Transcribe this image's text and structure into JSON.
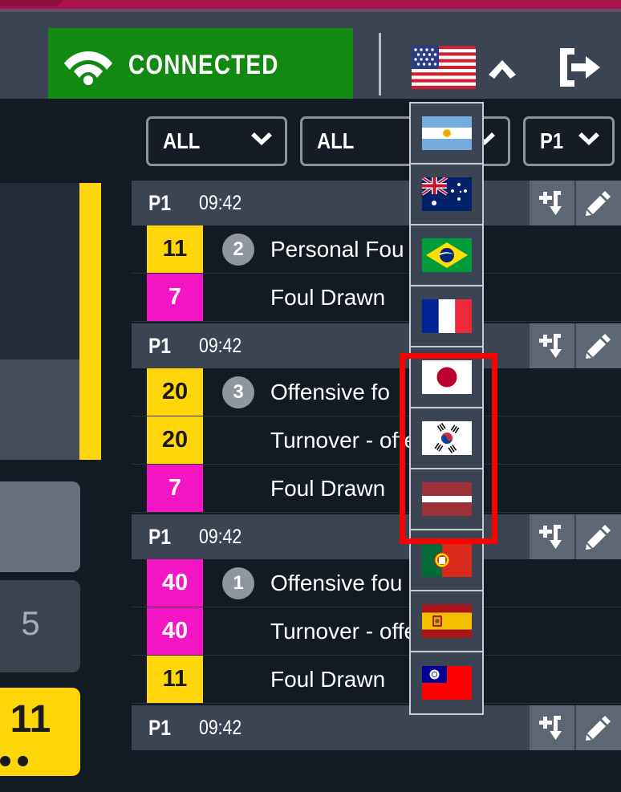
{
  "header": {
    "connected_label": "CONNECTED",
    "wifi_icon": "wifi-icon",
    "current_flag": "united-states-flag",
    "caret_icon": "chevron-up-icon",
    "logout_icon": "logout-icon",
    "green": "#128a12",
    "bar_bg": "#3b4452"
  },
  "topbar": {
    "accent": "#ac1150"
  },
  "filters": [
    {
      "name": "filter-team",
      "value": "ALL",
      "icon": "chevron-down-icon"
    },
    {
      "name": "filter-event-type",
      "value": "ALL",
      "icon": "chevron-down-icon"
    },
    {
      "name": "filter-period",
      "value": "P1",
      "icon": "chevron-down-icon"
    }
  ],
  "flag_dropdown": {
    "name": "language-flag-dropdown",
    "items": [
      {
        "code": "AR",
        "label": "argentina-flag"
      },
      {
        "code": "AU",
        "label": "australia-flag"
      },
      {
        "code": "BR",
        "label": "brazil-flag"
      },
      {
        "code": "FR",
        "label": "france-flag"
      },
      {
        "code": "JP",
        "label": "japan-flag"
      },
      {
        "code": "KR",
        "label": "south-korea-flag"
      },
      {
        "code": "LV",
        "label": "latvia-flag"
      },
      {
        "code": "PT",
        "label": "portugal-flag"
      },
      {
        "code": "ES",
        "label": "spain-flag"
      },
      {
        "code": "TW",
        "label": "taiwan-flag"
      }
    ]
  },
  "annotation": {
    "color": "#ff0000",
    "name": "red-highlight-box"
  },
  "action_buttons": {
    "add_icon": "add-substitute-icon",
    "edit_icon": "pencil-edit-icon"
  },
  "left_rail": {
    "card_a": {
      "name": "player-card-partial"
    },
    "card_b": {
      "number": "5"
    },
    "card_c": {
      "number": "11",
      "fouls": 2
    }
  },
  "event_groups": [
    {
      "period": "P1",
      "clock": "09:42",
      "rows": [
        {
          "number": "11",
          "color": "yellow",
          "count": "2",
          "text": "Personal Fou"
        },
        {
          "number": "7",
          "color": "magenta",
          "count": null,
          "text": "Foul Drawn"
        }
      ]
    },
    {
      "period": "P1",
      "clock": "09:42",
      "rows": [
        {
          "number": "20",
          "color": "yellow",
          "count": "3",
          "text": "Offensive fo"
        },
        {
          "number": "20",
          "color": "yellow",
          "count": null,
          "text": "Turnover - offensi"
        },
        {
          "number": "7",
          "color": "magenta",
          "count": null,
          "text": "Foul Drawn"
        }
      ]
    },
    {
      "period": "P1",
      "clock": "09:42",
      "rows": [
        {
          "number": "40",
          "color": "magenta",
          "count": "1",
          "text": "Offensive fou"
        },
        {
          "number": "40",
          "color": "magenta",
          "count": null,
          "text": "Turnover - offensi"
        },
        {
          "number": "11",
          "color": "yellow",
          "count": null,
          "text": "Foul Drawn"
        }
      ]
    },
    {
      "period": "P1",
      "clock": "09:42",
      "rows": []
    }
  ]
}
